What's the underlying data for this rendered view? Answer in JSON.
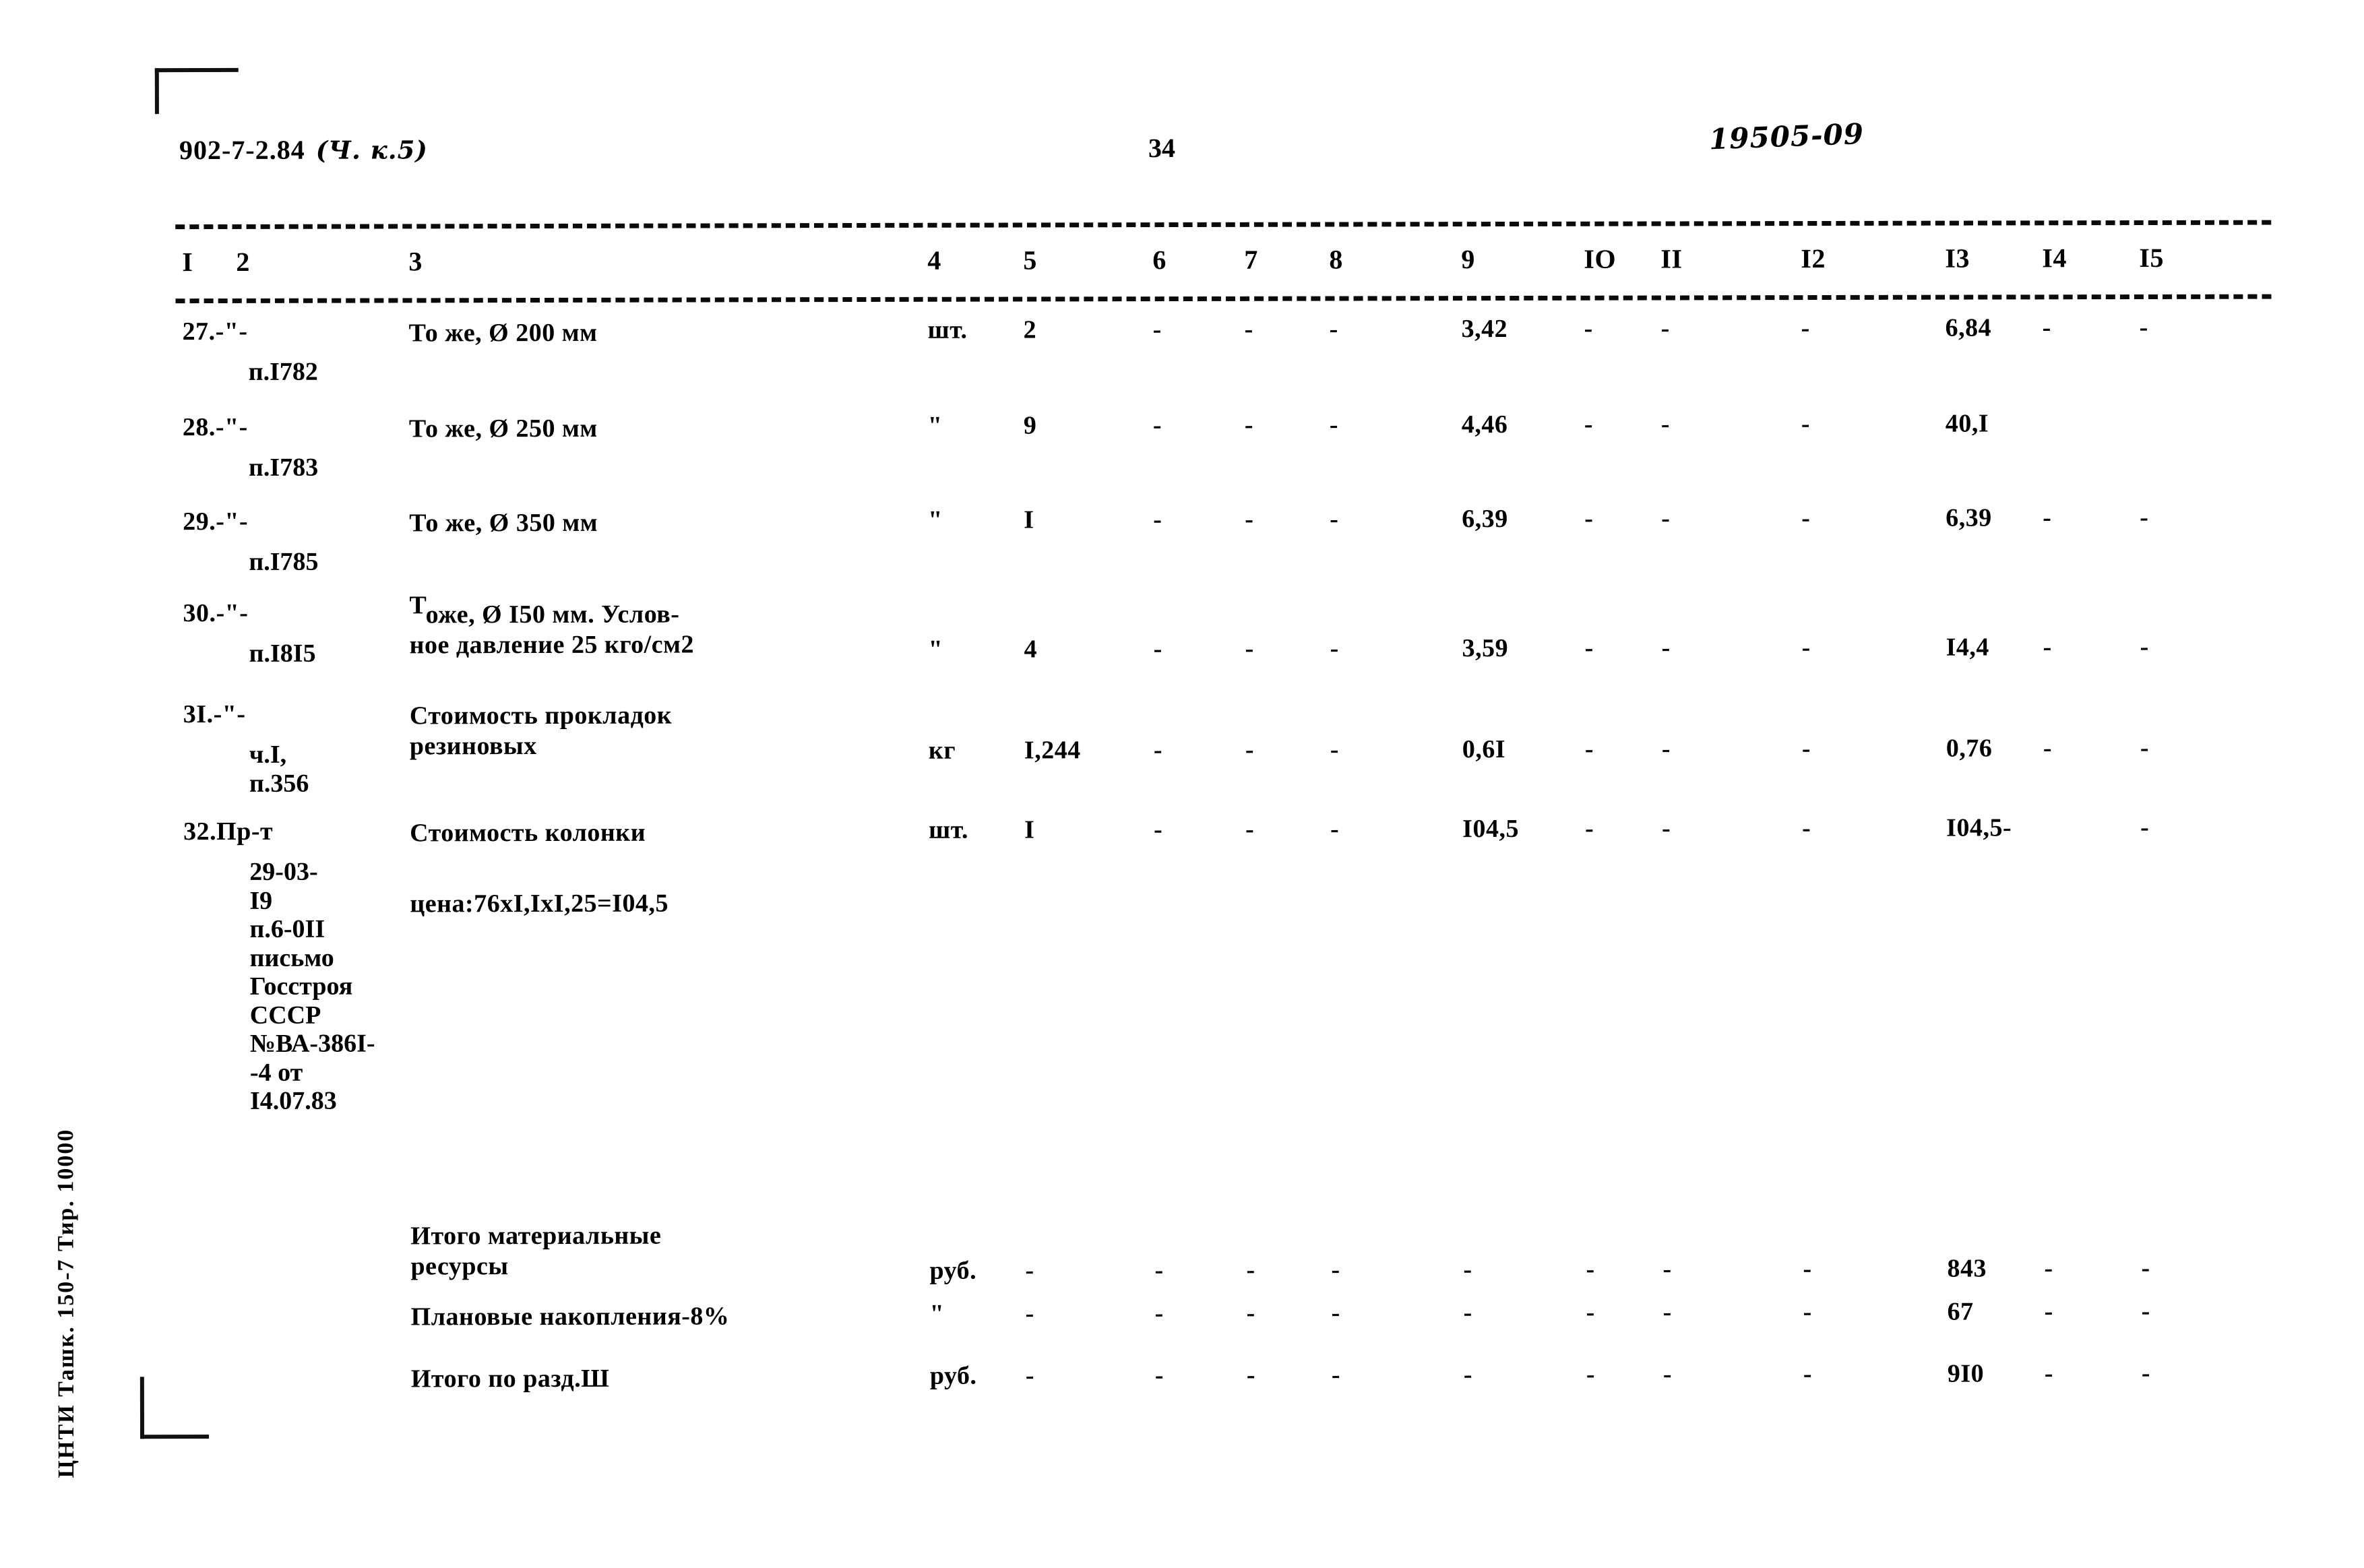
{
  "header": {
    "doc_code": "902-7-2.84",
    "doc_code_annotation": "(Ч. к.5)",
    "page_number": "34",
    "stamp": "19505-09"
  },
  "margin": {
    "imprint": "ЦНТИ Ташк. 150-7 Тир. 10000"
  },
  "table": {
    "column_headers": [
      "I",
      "2",
      "3",
      "4",
      "5",
      "6",
      "7",
      "8",
      "9",
      "IO",
      "II",
      "I2",
      "I3",
      "I4",
      "I5"
    ],
    "rows": [
      {
        "num": "27.-\"-",
        "ref_lines": [
          "п.I782"
        ],
        "desc_lines": [
          "То же, Ø 200 мм"
        ],
        "desc_raised_first": false,
        "c4": "шт.",
        "c5": "2",
        "c6": "-",
        "c7": "-",
        "c8": "-",
        "c9": "3,42",
        "c10": "-",
        "c11": "-",
        "c12": "-",
        "c13": "6,84",
        "c14": "-",
        "c15": "-"
      },
      {
        "num": "28.-\"-",
        "ref_lines": [
          "п.I783"
        ],
        "desc_lines": [
          "То же, Ø 250 мм"
        ],
        "desc_raised_first": false,
        "c4": "\"",
        "c5": "9",
        "c6": "-",
        "c7": "-",
        "c8": "-",
        "c9": "4,46",
        "c10": "-",
        "c11": "-",
        "c12": "-",
        "c13": "40,I",
        "c14": "",
        "c15": ""
      },
      {
        "num": "29.-\"-",
        "ref_lines": [
          "п.I785"
        ],
        "desc_lines": [
          "То же, Ø 350 мм"
        ],
        "desc_raised_first": false,
        "c4": "\"",
        "c5": "I",
        "c6": "-",
        "c7": "-",
        "c8": "-",
        "c9": "6,39",
        "c10": "-",
        "c11": "-",
        "c12": "-",
        "c13": "6,39",
        "c14": "-",
        "c15": "-"
      },
      {
        "num": "30.-\"-",
        "ref_lines": [
          "п.I8I5"
        ],
        "desc_lines": [
          "оже, Ø I50 мм. Услов-",
          "ное давление 25 кго/см2"
        ],
        "desc_raised_first": true,
        "desc_raised_char": "Т",
        "c4": "\"",
        "c5": "4",
        "c6": "-",
        "c7": "-",
        "c8": "-",
        "c9": "3,59",
        "c10": "-",
        "c11": "-",
        "c12": "-",
        "c13": "I4,4",
        "c14": "-",
        "c15": "-"
      },
      {
        "num": "3I.-\"-",
        "ref_lines": [
          "ч.I,",
          "п.356"
        ],
        "desc_lines": [
          "Стоимость прокладок",
          "резиновых"
        ],
        "desc_raised_first": false,
        "c4": "кг",
        "c5": "I,244",
        "c6": "-",
        "c7": "-",
        "c8": "-",
        "c9": "0,6I",
        "c10": "-",
        "c11": "-",
        "c12": "-",
        "c13": "0,76",
        "c14": "-",
        "c15": "-"
      },
      {
        "num": "32.Пр-т",
        "ref_lines": [
          "29-03-",
          "I9",
          "п.6-0II",
          "письмо",
          "Госстроя",
          "СССР",
          "№ВА-386I-",
          "-4 от",
          "I4.07.83"
        ],
        "desc_lines": [
          "Стоимость колонки"
        ],
        "desc_raised_first": false,
        "note": "цена:76хI,IхI,25=I04,5",
        "c4": "шт.",
        "c5": "I",
        "c6": "-",
        "c7": "-",
        "c8": "-",
        "c9": "I04,5",
        "c10": "-",
        "c11": "-",
        "c12": "-",
        "c13": "I04,5-",
        "c14": "",
        "c15": "-"
      }
    ],
    "summary_rows": [
      {
        "desc_lines": [
          "Итого материальные",
          "ресурсы"
        ],
        "c4": "руб.",
        "c5": "-",
        "c6": "-",
        "c7": "-",
        "c8": "-",
        "c9": "-",
        "c10": "-",
        "c11": "-",
        "c12": "-",
        "c13": "843",
        "c14": "-",
        "c15": "-"
      },
      {
        "desc_lines": [
          "Плановые накопления-8%"
        ],
        "c4": "\"",
        "c5": "-",
        "c6": "-",
        "c7": "-",
        "c8": "-",
        "c9": "-",
        "c10": "-",
        "c11": "-",
        "c12": "-",
        "c13": "67",
        "c14": "-",
        "c15": "-"
      },
      {
        "desc_lines": [
          "Итого по разд.Ш"
        ],
        "c4": "руб.",
        "c5": "-",
        "c6": "-",
        "c7": "-",
        "c8": "-",
        "c9": "-",
        "c10": "-",
        "c11": "-",
        "c12": "-",
        "c13": "9I0",
        "c14": "-",
        "c15": "-"
      }
    ]
  }
}
